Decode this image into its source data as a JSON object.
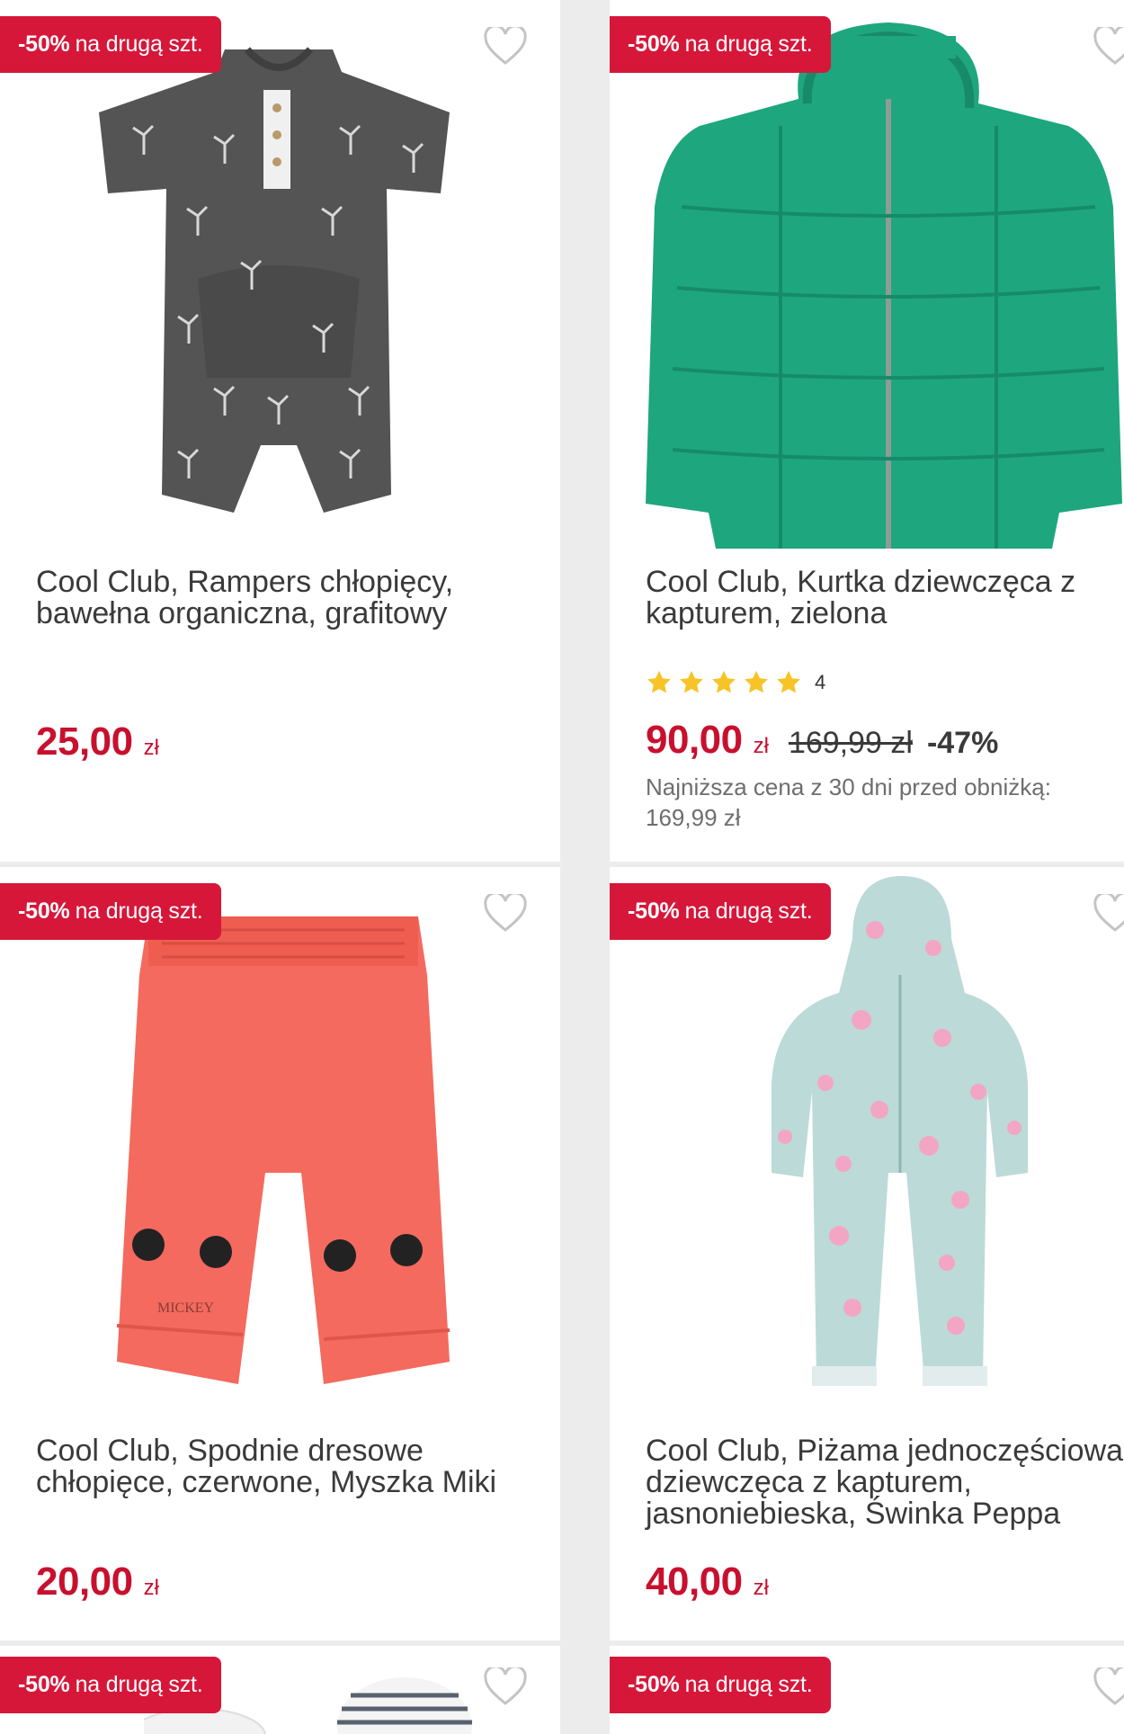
{
  "colors": {
    "badge_bg": "#d6173a",
    "price": "#c8102e",
    "star": "#f7c327",
    "page_bg": "#ececec",
    "card_bg": "#ffffff"
  },
  "icons": {
    "favorite": "heart-outline-icon",
    "rating": "star-icon"
  },
  "products": [
    {
      "badge_strong": "-50%",
      "badge_text": "na drugą szt.",
      "title": "Cool Club, Rampers chłopięcy, bawełna organiczna, grafitowy",
      "price": "25,00",
      "currency": "zł",
      "image_desc": "romper-graphite"
    },
    {
      "badge_strong": "-50%",
      "badge_text": "na drugą szt.",
      "title": "Cool Club, Kurtka dziewczęca z kapturem, zielona",
      "rating_stars": 5,
      "rating_count": "4",
      "price": "90,00",
      "currency": "zł",
      "old_price": "169,99 zł",
      "discount": "-47%",
      "lowest_price_note": "Najniższa cena z 30 dni przed obniżką: 169,99 zł",
      "image_desc": "jacket-green"
    },
    {
      "badge_strong": "-50%",
      "badge_text": "na drugą szt.",
      "title": "Cool Club, Spodnie dresowe chłopięce, czerwone, Myszka Miki",
      "price": "20,00",
      "currency": "zł",
      "image_desc": "pants-red",
      "image_print_text": "MICKEY"
    },
    {
      "badge_strong": "-50%",
      "badge_text": "na drugą szt.",
      "title": "Cool Club, Piżama jednoczęściowa dziewczęca z kapturem, jasnoniebieska, Świnka Peppa",
      "price": "40,00",
      "currency": "zł",
      "image_desc": "pyjama-lightblue"
    },
    {
      "badge_strong": "-50%",
      "badge_text": "na drugą szt."
    },
    {
      "badge_strong": "-50%",
      "badge_text": "na drugą szt."
    }
  ]
}
